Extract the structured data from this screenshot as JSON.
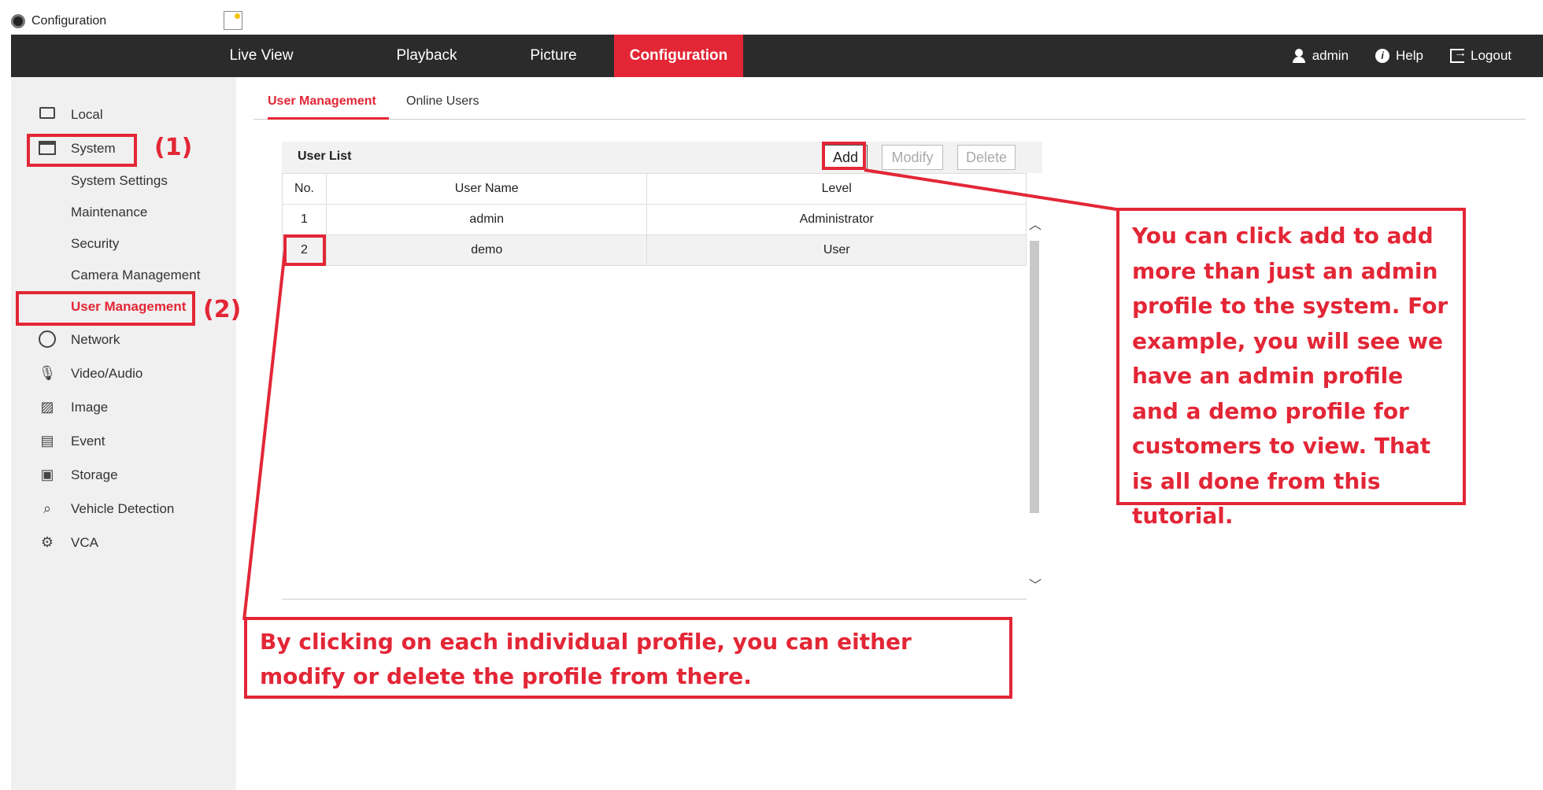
{
  "browser_tab": {
    "title": "Configuration",
    "close": "×"
  },
  "topnav": {
    "items": [
      "Live View",
      "Playback",
      "Picture",
      "Configuration"
    ],
    "active": "Configuration",
    "user": "admin",
    "help": "Help",
    "logout": "Logout"
  },
  "sidebar": {
    "local": "Local",
    "system": "System",
    "system_settings": "System Settings",
    "maintenance": "Maintenance",
    "security": "Security",
    "camera_management": "Camera Management",
    "user_management": "User Management",
    "network": "Network",
    "video_audio": "Video/Audio",
    "image": "Image",
    "event": "Event",
    "storage": "Storage",
    "vehicle_detection": "Vehicle Detection",
    "vca": "VCA"
  },
  "content_tabs": {
    "user_management": "User Management",
    "online_users": "Online Users"
  },
  "user_list": {
    "title": "User List",
    "add": "Add",
    "modify": "Modify",
    "delete": "Delete",
    "columns": {
      "no": "No.",
      "user_name": "User Name",
      "level": "Level"
    },
    "rows": [
      {
        "no": "1",
        "user_name": "admin",
        "level": "Administrator"
      },
      {
        "no": "2",
        "user_name": "demo",
        "level": "User"
      }
    ]
  },
  "annotations": {
    "label_1": "(1)",
    "label_2": "(2)",
    "right_note": "You can click add to add more than just an admin profile to the system. For example, you will see we have an admin profile and a demo profile for customers to view. That is all done from this tutorial.",
    "bottom_note": "By clicking on each individual profile, you can either modify or delete the profile from there."
  },
  "colors": {
    "accent": "#e32636",
    "nav_bg": "#2b2b2b",
    "sidebar_bg": "#f0f0f0"
  }
}
